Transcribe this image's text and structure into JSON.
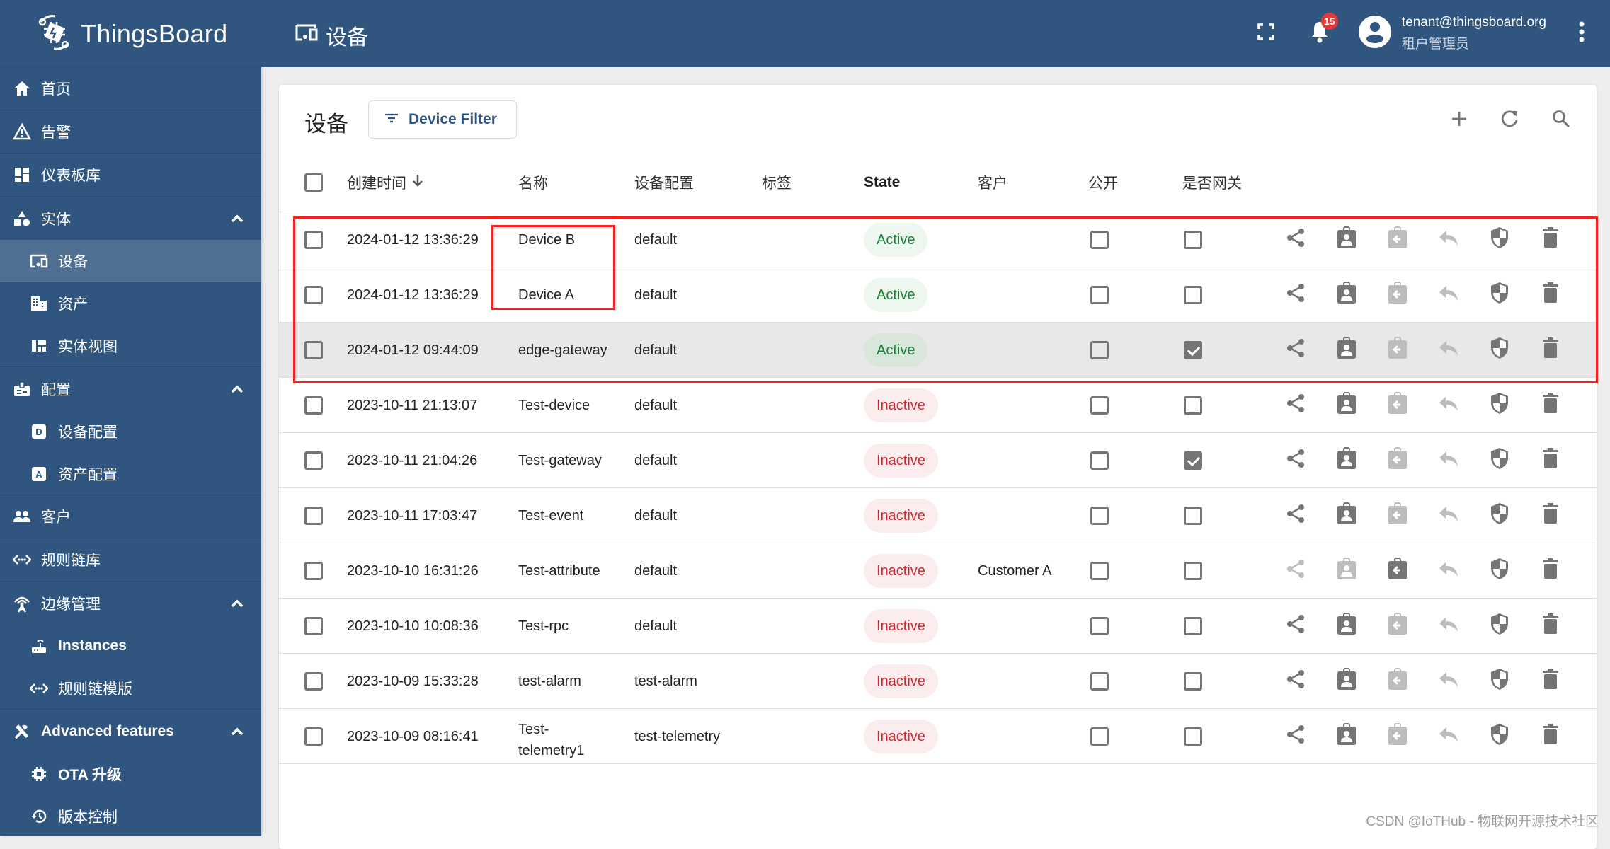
{
  "app": {
    "name": "ThingsBoard"
  },
  "header": {
    "page_title": "设备",
    "notifications_count": "15",
    "user_email": "tenant@thingsboard.org",
    "user_role": "租户管理员"
  },
  "sidebar": {
    "items": [
      {
        "label": "首页",
        "icon": "home-icon",
        "level": "top"
      },
      {
        "label": "告警",
        "icon": "warning-icon",
        "level": "top"
      },
      {
        "label": "仪表板库",
        "icon": "dashboard-icon",
        "level": "top"
      },
      {
        "label": "实体",
        "icon": "category-icon",
        "level": "top",
        "expanded": true
      },
      {
        "label": "设备",
        "icon": "devices-icon",
        "level": "sub",
        "active": true
      },
      {
        "label": "资产",
        "icon": "domain-icon",
        "level": "sub"
      },
      {
        "label": "实体视图",
        "icon": "view-quilt-icon",
        "level": "sub"
      },
      {
        "label": "配置",
        "icon": "badge-icon",
        "level": "top",
        "expanded": true
      },
      {
        "label": "设备配置",
        "icon": "device-profile-icon",
        "level": "sub"
      },
      {
        "label": "资产配置",
        "icon": "asset-profile-icon",
        "level": "sub"
      },
      {
        "label": "客户",
        "icon": "people-icon",
        "level": "top"
      },
      {
        "label": "规则链库",
        "icon": "settings-ethernet-icon",
        "level": "top"
      },
      {
        "label": "边缘管理",
        "icon": "edge-icon",
        "level": "top",
        "expanded": true
      },
      {
        "label": "Instances",
        "icon": "router-icon",
        "level": "sub"
      },
      {
        "label": "规则链模版",
        "icon": "settings-ethernet-icon",
        "level": "sub"
      },
      {
        "label": "Advanced features",
        "icon": "construction-icon",
        "level": "top",
        "expanded": true
      },
      {
        "label": "OTA 升级",
        "icon": "memory-icon",
        "level": "sub"
      },
      {
        "label": "版本控制",
        "icon": "history-icon",
        "level": "sub"
      }
    ]
  },
  "card": {
    "title": "设备",
    "filter_label": "Device Filter",
    "actions": [
      "add-icon",
      "refresh-icon",
      "search-icon"
    ]
  },
  "table": {
    "columns": {
      "created": "创建时间",
      "sort_indicator": "↓",
      "name": "名称",
      "profile": "设备配置",
      "label": "标签",
      "state": "State",
      "customer": "客户",
      "public": "公开",
      "gateway": "是否网关"
    },
    "rows": [
      {
        "created": "2024-01-12 13:36:29",
        "name": "Device B",
        "profile": "default",
        "label": "",
        "state": "Active",
        "customer": "",
        "public": false,
        "gateway": false,
        "assigned": false
      },
      {
        "created": "2024-01-12 13:36:29",
        "name": "Device A",
        "profile": "default",
        "label": "",
        "state": "Active",
        "customer": "",
        "public": false,
        "gateway": false,
        "assigned": false
      },
      {
        "created": "2024-01-12 09:44:09",
        "name": "edge-gateway",
        "profile": "default",
        "label": "",
        "state": "Active",
        "customer": "",
        "public": false,
        "gateway": true,
        "assigned": false,
        "highlighted": true
      },
      {
        "created": "2023-10-11 21:13:07",
        "name": "Test-device",
        "profile": "default",
        "label": "",
        "state": "Inactive",
        "customer": "",
        "public": false,
        "gateway": false,
        "assigned": false
      },
      {
        "created": "2023-10-11 21:04:26",
        "name": "Test-gateway",
        "profile": "default",
        "label": "",
        "state": "Inactive",
        "customer": "",
        "public": false,
        "gateway": true,
        "assigned": false
      },
      {
        "created": "2023-10-11 17:03:47",
        "name": "Test-event",
        "profile": "default",
        "label": "",
        "state": "Inactive",
        "customer": "",
        "public": false,
        "gateway": false,
        "assigned": false
      },
      {
        "created": "2023-10-10 16:31:26",
        "name": "Test-attribute",
        "profile": "default",
        "label": "",
        "state": "Inactive",
        "customer": "Customer A",
        "public": false,
        "gateway": false,
        "assigned": true
      },
      {
        "created": "2023-10-10 10:08:36",
        "name": "Test-rpc",
        "profile": "default",
        "label": "",
        "state": "Inactive",
        "customer": "",
        "public": false,
        "gateway": false,
        "assigned": false
      },
      {
        "created": "2023-10-09 15:33:28",
        "name": "test-alarm",
        "profile": "test-alarm",
        "label": "",
        "state": "Inactive",
        "customer": "",
        "public": false,
        "gateway": false,
        "assigned": false
      },
      {
        "created": "2023-10-09 08:16:41",
        "name": "Test-telemetry1",
        "name_display": "Test-\ntelemetry1",
        "profile": "test-telemetry",
        "label": "",
        "state": "Inactive",
        "customer": "",
        "public": false,
        "gateway": false,
        "assigned": false
      }
    ],
    "row_actions": [
      "share-icon",
      "assign-to-customer-icon",
      "unassign-from-customer-icon",
      "unassign-from-edge-icon",
      "manage-credentials-icon",
      "delete-icon"
    ]
  },
  "colors": {
    "primary": "#305680",
    "active_text": "#198038",
    "active_bg": "#edf6ef",
    "inactive_text": "#d12730",
    "inactive_bg": "#fbeced",
    "annotation_red": "#ff1e1e"
  },
  "watermark": "CSDN @IoTHub - 物联网开源技术社区"
}
